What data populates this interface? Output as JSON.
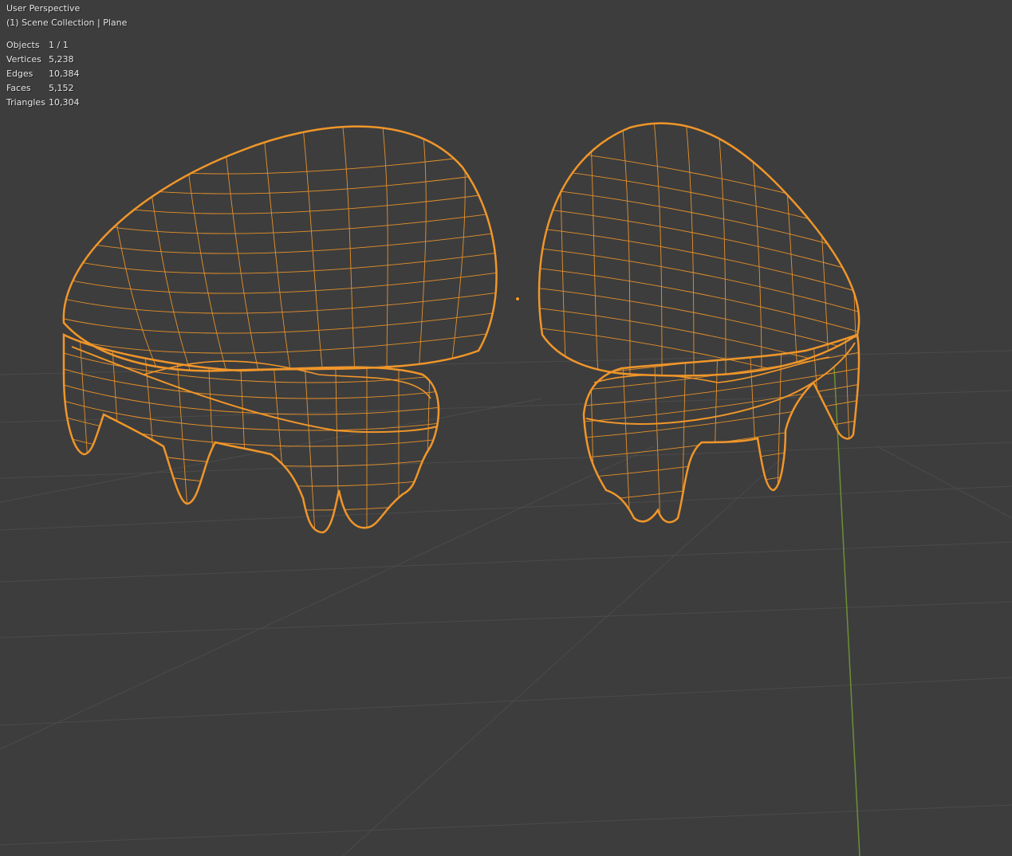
{
  "viewport": {
    "view_name": "User Perspective",
    "collection_line": "(1) Scene Collection | Plane",
    "stats": [
      {
        "label": "Objects",
        "value": "1 / 1"
      },
      {
        "label": "Vertices",
        "value": "5,238"
      },
      {
        "label": "Edges",
        "value": "10,384"
      },
      {
        "label": "Faces",
        "value": "5,152"
      },
      {
        "label": "Triangles",
        "value": "10,304"
      }
    ]
  },
  "colors": {
    "background": "#3d3d3d",
    "grid": "#4a4a4a",
    "y_axis": "#6c8f34",
    "wireframe_selected": "#f0962a",
    "origin": "#f0962a",
    "overlay_text": "#e6e6e6"
  }
}
